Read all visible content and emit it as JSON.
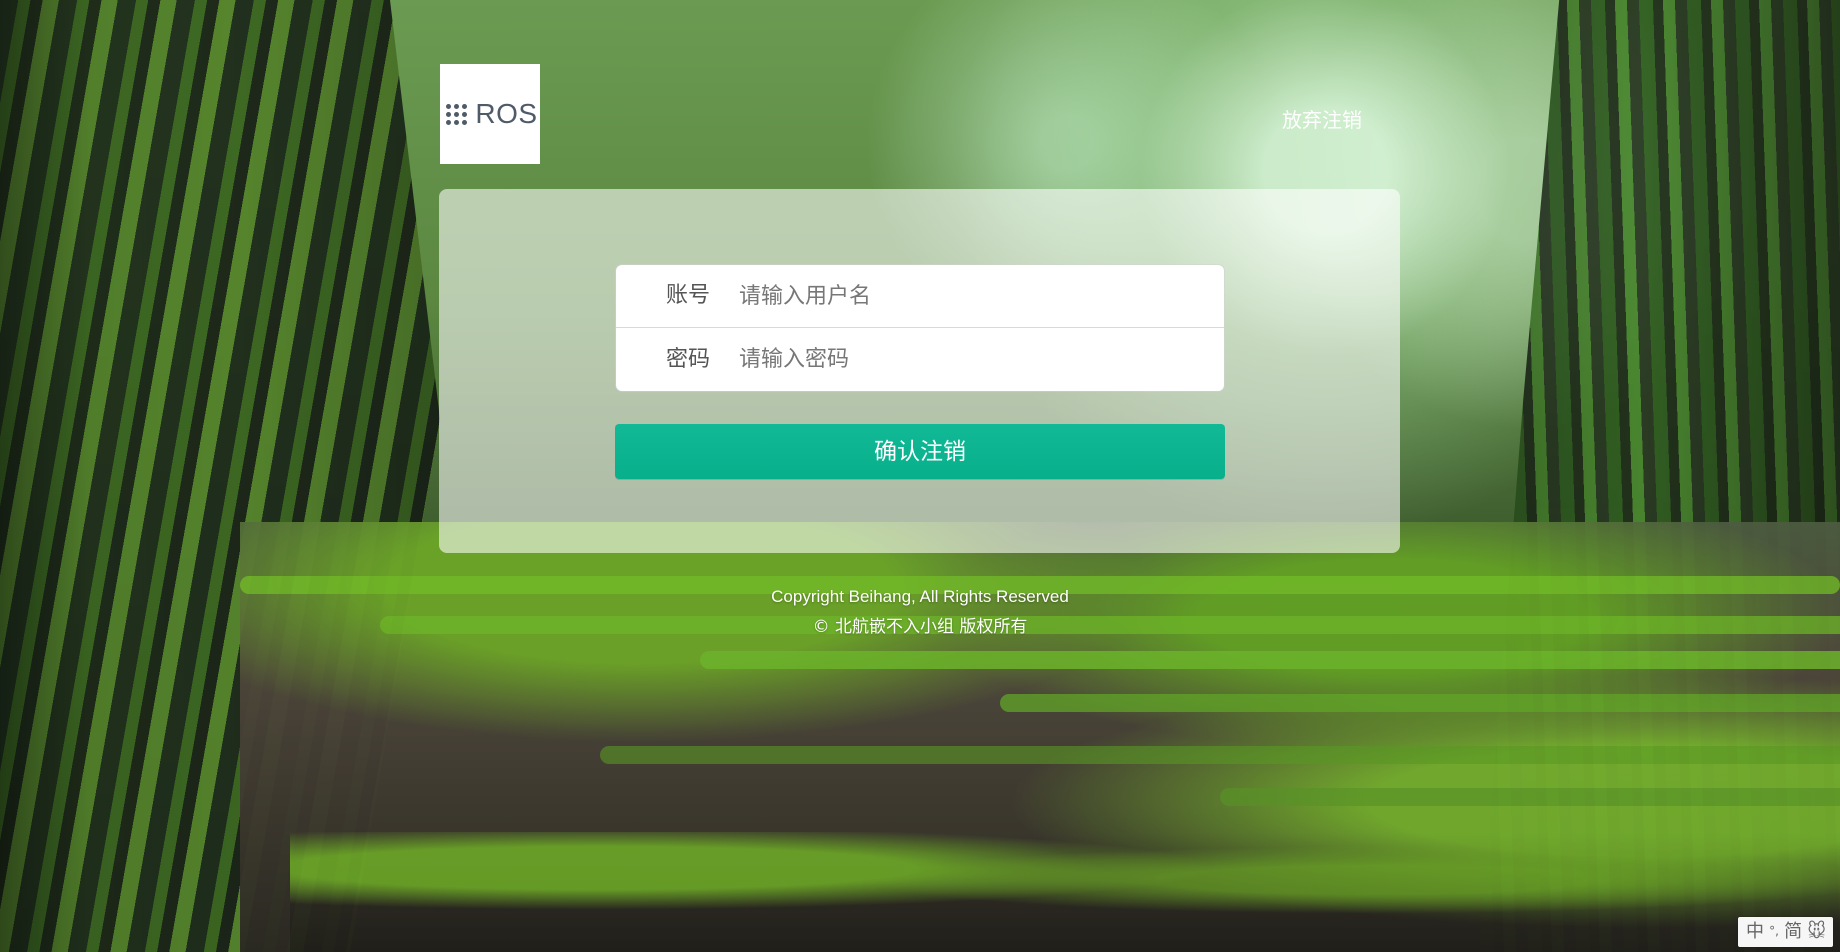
{
  "logo": {
    "text": "ROS"
  },
  "header": {
    "cancel_link": "放弃注销"
  },
  "form": {
    "account_label": "账号",
    "account_placeholder": "请输入用户名",
    "password_label": "密码",
    "password_placeholder": "请输入密码",
    "confirm_button": "确认注销"
  },
  "footer": {
    "copyright_en": "Copyright Beihang, All Rights Reserved",
    "copyright_cn": "© 北航嵌不入小组 版权所有"
  },
  "ime": {
    "lang": "中",
    "punctuation": "°,",
    "script": "简",
    "mode": "🐭"
  },
  "colors": {
    "confirm_button": "#0fb393",
    "panel_overlay": "rgba(255,255,255,0.58)",
    "logo_text": "#4f5b68"
  },
  "icons": {
    "logo": "grid-dots-icon",
    "ime_mode": "mouse-icon"
  }
}
